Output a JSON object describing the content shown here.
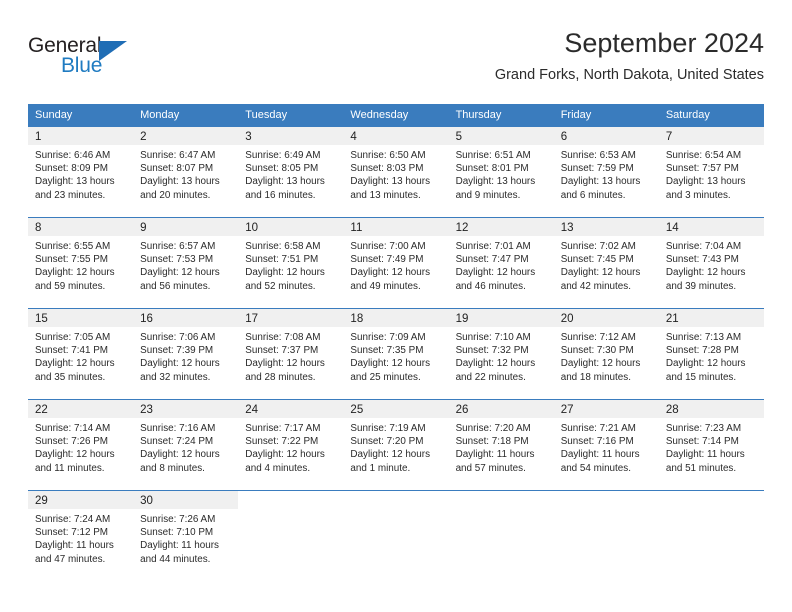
{
  "logo": {
    "word_top": "General",
    "word_bottom": "Blue",
    "accent_color": "#1f6db5"
  },
  "header": {
    "title": "September 2024",
    "subtitle": "Grand Forks, North Dakota, United States"
  },
  "theme": {
    "header_blue": "#3a7cbe",
    "daynum_band": "#f0f0f0",
    "text": "#2b2b2b"
  },
  "weekday_headers": [
    "Sunday",
    "Monday",
    "Tuesday",
    "Wednesday",
    "Thursday",
    "Friday",
    "Saturday"
  ],
  "weeks": [
    [
      {
        "day": "1",
        "sunrise": "Sunrise: 6:46 AM",
        "sunset": "Sunset: 8:09 PM",
        "daylight1": "Daylight: 13 hours",
        "daylight2": "and 23 minutes."
      },
      {
        "day": "2",
        "sunrise": "Sunrise: 6:47 AM",
        "sunset": "Sunset: 8:07 PM",
        "daylight1": "Daylight: 13 hours",
        "daylight2": "and 20 minutes."
      },
      {
        "day": "3",
        "sunrise": "Sunrise: 6:49 AM",
        "sunset": "Sunset: 8:05 PM",
        "daylight1": "Daylight: 13 hours",
        "daylight2": "and 16 minutes."
      },
      {
        "day": "4",
        "sunrise": "Sunrise: 6:50 AM",
        "sunset": "Sunset: 8:03 PM",
        "daylight1": "Daylight: 13 hours",
        "daylight2": "and 13 minutes."
      },
      {
        "day": "5",
        "sunrise": "Sunrise: 6:51 AM",
        "sunset": "Sunset: 8:01 PM",
        "daylight1": "Daylight: 13 hours",
        "daylight2": "and 9 minutes."
      },
      {
        "day": "6",
        "sunrise": "Sunrise: 6:53 AM",
        "sunset": "Sunset: 7:59 PM",
        "daylight1": "Daylight: 13 hours",
        "daylight2": "and 6 minutes."
      },
      {
        "day": "7",
        "sunrise": "Sunrise: 6:54 AM",
        "sunset": "Sunset: 7:57 PM",
        "daylight1": "Daylight: 13 hours",
        "daylight2": "and 3 minutes."
      }
    ],
    [
      {
        "day": "8",
        "sunrise": "Sunrise: 6:55 AM",
        "sunset": "Sunset: 7:55 PM",
        "daylight1": "Daylight: 12 hours",
        "daylight2": "and 59 minutes."
      },
      {
        "day": "9",
        "sunrise": "Sunrise: 6:57 AM",
        "sunset": "Sunset: 7:53 PM",
        "daylight1": "Daylight: 12 hours",
        "daylight2": "and 56 minutes."
      },
      {
        "day": "10",
        "sunrise": "Sunrise: 6:58 AM",
        "sunset": "Sunset: 7:51 PM",
        "daylight1": "Daylight: 12 hours",
        "daylight2": "and 52 minutes."
      },
      {
        "day": "11",
        "sunrise": "Sunrise: 7:00 AM",
        "sunset": "Sunset: 7:49 PM",
        "daylight1": "Daylight: 12 hours",
        "daylight2": "and 49 minutes."
      },
      {
        "day": "12",
        "sunrise": "Sunrise: 7:01 AM",
        "sunset": "Sunset: 7:47 PM",
        "daylight1": "Daylight: 12 hours",
        "daylight2": "and 46 minutes."
      },
      {
        "day": "13",
        "sunrise": "Sunrise: 7:02 AM",
        "sunset": "Sunset: 7:45 PM",
        "daylight1": "Daylight: 12 hours",
        "daylight2": "and 42 minutes."
      },
      {
        "day": "14",
        "sunrise": "Sunrise: 7:04 AM",
        "sunset": "Sunset: 7:43 PM",
        "daylight1": "Daylight: 12 hours",
        "daylight2": "and 39 minutes."
      }
    ],
    [
      {
        "day": "15",
        "sunrise": "Sunrise: 7:05 AM",
        "sunset": "Sunset: 7:41 PM",
        "daylight1": "Daylight: 12 hours",
        "daylight2": "and 35 minutes."
      },
      {
        "day": "16",
        "sunrise": "Sunrise: 7:06 AM",
        "sunset": "Sunset: 7:39 PM",
        "daylight1": "Daylight: 12 hours",
        "daylight2": "and 32 minutes."
      },
      {
        "day": "17",
        "sunrise": "Sunrise: 7:08 AM",
        "sunset": "Sunset: 7:37 PM",
        "daylight1": "Daylight: 12 hours",
        "daylight2": "and 28 minutes."
      },
      {
        "day": "18",
        "sunrise": "Sunrise: 7:09 AM",
        "sunset": "Sunset: 7:35 PM",
        "daylight1": "Daylight: 12 hours",
        "daylight2": "and 25 minutes."
      },
      {
        "day": "19",
        "sunrise": "Sunrise: 7:10 AM",
        "sunset": "Sunset: 7:32 PM",
        "daylight1": "Daylight: 12 hours",
        "daylight2": "and 22 minutes."
      },
      {
        "day": "20",
        "sunrise": "Sunrise: 7:12 AM",
        "sunset": "Sunset: 7:30 PM",
        "daylight1": "Daylight: 12 hours",
        "daylight2": "and 18 minutes."
      },
      {
        "day": "21",
        "sunrise": "Sunrise: 7:13 AM",
        "sunset": "Sunset: 7:28 PM",
        "daylight1": "Daylight: 12 hours",
        "daylight2": "and 15 minutes."
      }
    ],
    [
      {
        "day": "22",
        "sunrise": "Sunrise: 7:14 AM",
        "sunset": "Sunset: 7:26 PM",
        "daylight1": "Daylight: 12 hours",
        "daylight2": "and 11 minutes."
      },
      {
        "day": "23",
        "sunrise": "Sunrise: 7:16 AM",
        "sunset": "Sunset: 7:24 PM",
        "daylight1": "Daylight: 12 hours",
        "daylight2": "and 8 minutes."
      },
      {
        "day": "24",
        "sunrise": "Sunrise: 7:17 AM",
        "sunset": "Sunset: 7:22 PM",
        "daylight1": "Daylight: 12 hours",
        "daylight2": "and 4 minutes."
      },
      {
        "day": "25",
        "sunrise": "Sunrise: 7:19 AM",
        "sunset": "Sunset: 7:20 PM",
        "daylight1": "Daylight: 12 hours",
        "daylight2": "and 1 minute."
      },
      {
        "day": "26",
        "sunrise": "Sunrise: 7:20 AM",
        "sunset": "Sunset: 7:18 PM",
        "daylight1": "Daylight: 11 hours",
        "daylight2": "and 57 minutes."
      },
      {
        "day": "27",
        "sunrise": "Sunrise: 7:21 AM",
        "sunset": "Sunset: 7:16 PM",
        "daylight1": "Daylight: 11 hours",
        "daylight2": "and 54 minutes."
      },
      {
        "day": "28",
        "sunrise": "Sunrise: 7:23 AM",
        "sunset": "Sunset: 7:14 PM",
        "daylight1": "Daylight: 11 hours",
        "daylight2": "and 51 minutes."
      }
    ],
    [
      {
        "day": "29",
        "sunrise": "Sunrise: 7:24 AM",
        "sunset": "Sunset: 7:12 PM",
        "daylight1": "Daylight: 11 hours",
        "daylight2": "and 47 minutes."
      },
      {
        "day": "30",
        "sunrise": "Sunrise: 7:26 AM",
        "sunset": "Sunset: 7:10 PM",
        "daylight1": "Daylight: 11 hours",
        "daylight2": "and 44 minutes."
      },
      {
        "day": "",
        "sunrise": "",
        "sunset": "",
        "daylight1": "",
        "daylight2": ""
      },
      {
        "day": "",
        "sunrise": "",
        "sunset": "",
        "daylight1": "",
        "daylight2": ""
      },
      {
        "day": "",
        "sunrise": "",
        "sunset": "",
        "daylight1": "",
        "daylight2": ""
      },
      {
        "day": "",
        "sunrise": "",
        "sunset": "",
        "daylight1": "",
        "daylight2": ""
      },
      {
        "day": "",
        "sunrise": "",
        "sunset": "",
        "daylight1": "",
        "daylight2": ""
      }
    ]
  ]
}
